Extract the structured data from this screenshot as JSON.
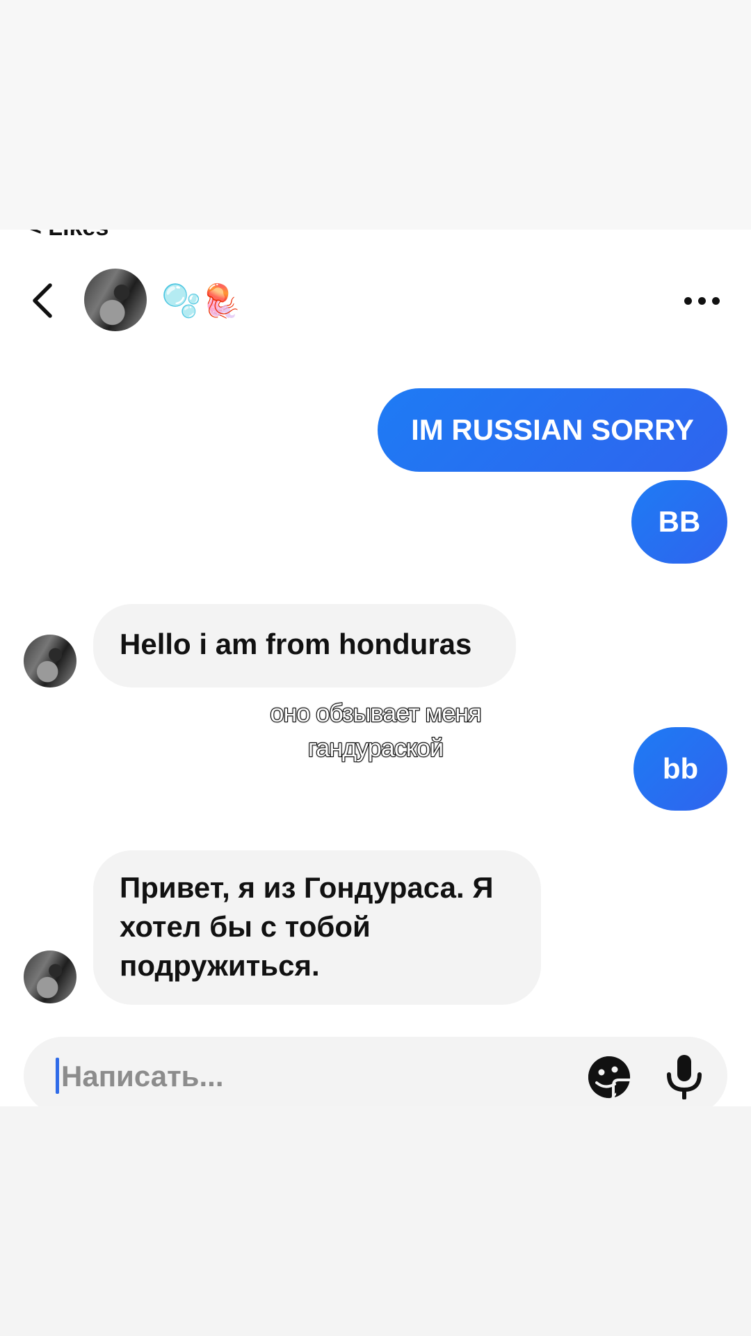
{
  "top_cut_label": "< Likes",
  "header": {
    "contact_name": "🫧🪼"
  },
  "messages": [
    {
      "direction": "outgoing",
      "text": "IM RUSSIAN SORRY"
    },
    {
      "direction": "outgoing",
      "text": "BB"
    },
    {
      "direction": "incoming",
      "text": "Hello i am from honduras"
    },
    {
      "direction": "outgoing",
      "text": "bb"
    },
    {
      "direction": "incoming",
      "text": "Привет, я из Гондураса. Я хотел бы с тобой подружиться."
    }
  ],
  "overlay_caption": "оно обзывает меня гандураской",
  "composer": {
    "placeholder": "Написать..."
  },
  "colors": {
    "outgoing_bubble": "#2f64ee",
    "incoming_bubble": "#f3f3f3",
    "caret": "#2f6be8"
  },
  "icons": [
    "chevron-left-icon",
    "more-dots-icon",
    "sticker-icon",
    "microphone-icon"
  ]
}
